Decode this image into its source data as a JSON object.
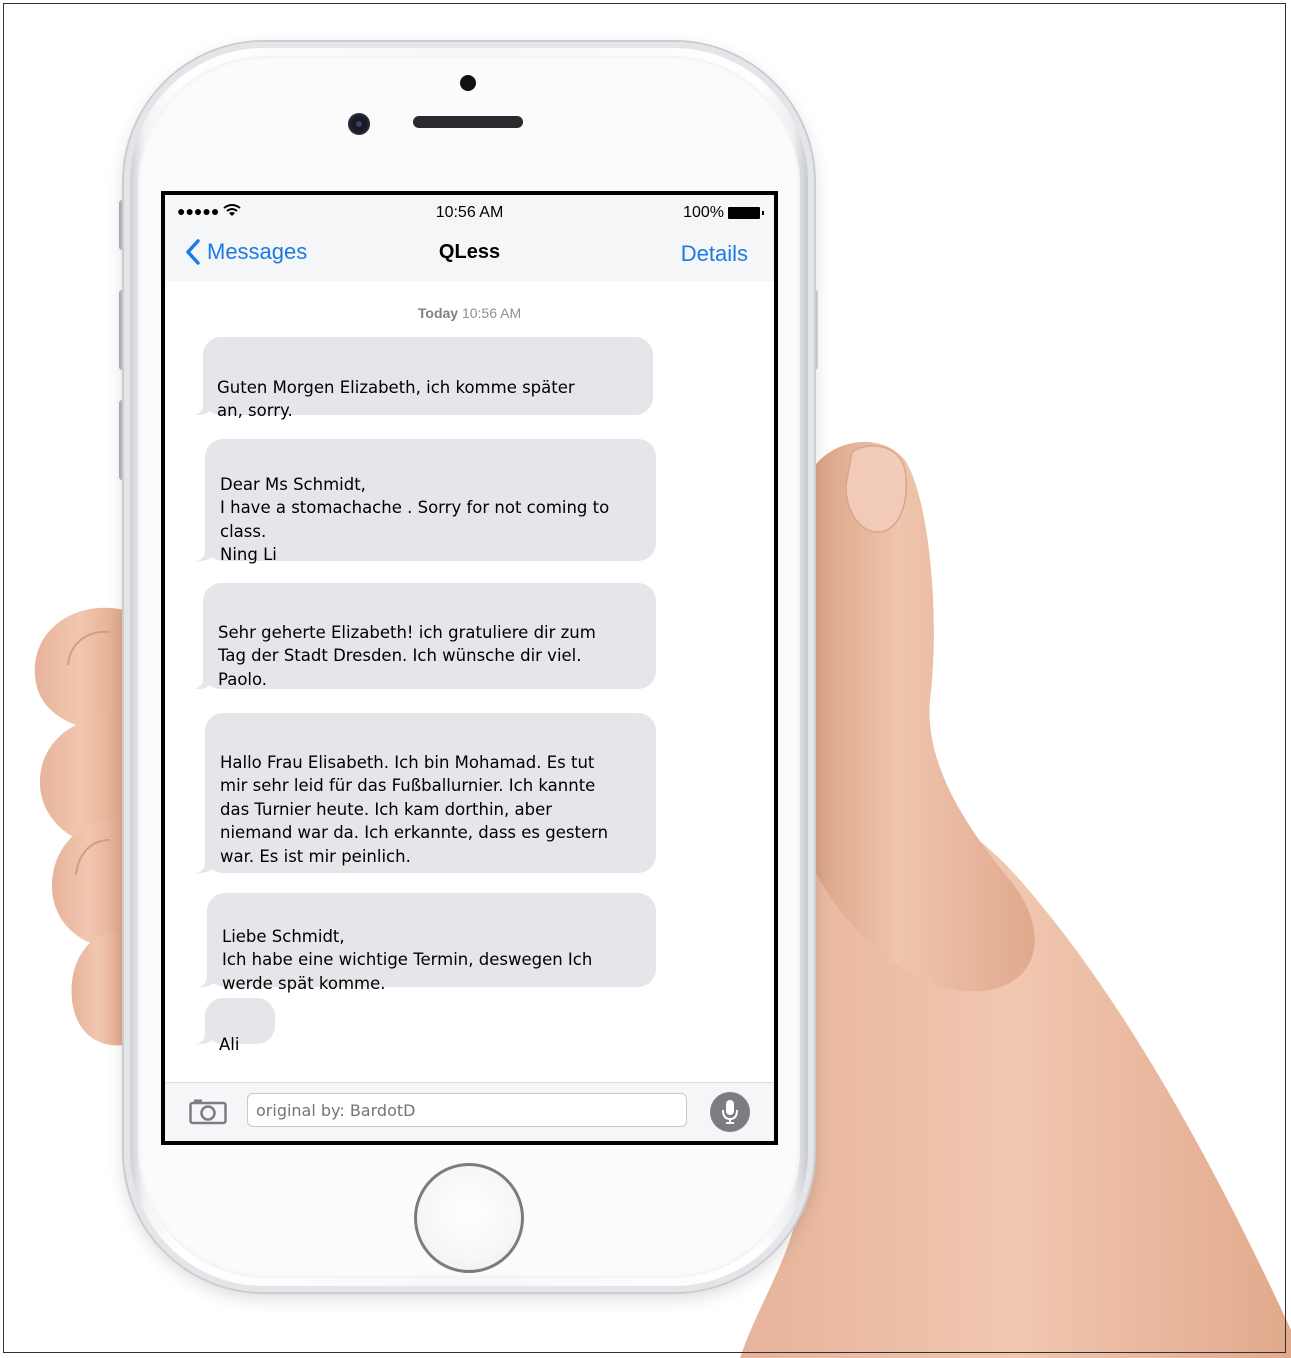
{
  "status_bar": {
    "signal": "●●●●● ",
    "time": "10:56 AM",
    "battery": "100%"
  },
  "nav": {
    "back_label": "Messages",
    "title": "QLess",
    "details_label": "Details"
  },
  "conversation": {
    "date_day": "Today",
    "date_time": "10:56 AM",
    "messages": [
      {
        "text": "Guten Morgen Elizabeth, ich komme später\nan, sorry."
      },
      {
        "text": "Dear Ms Schmidt,\nI have a stomachache . Sorry for not coming to\nclass.\nNing Li"
      },
      {
        "text": "Sehr geherte Elizabeth! ich gratuliere dir zum\nTag der Stadt Dresden. Ich wünsche dir viel.\nPaolo."
      },
      {
        "text": "Hallo Frau Elisabeth. Ich bin Mohamad. Es tut\nmir sehr leid für das Fußballurnier. Ich kannte\ndas Turnier heute. Ich kam dorthin, aber\nniemand war da. Ich erkannte, dass es gestern\nwar. Es ist mir peinlich."
      },
      {
        "text": "Liebe Schmidt,\nIch habe eine wichtige Termin, deswegen Ich\nwerde spät komme."
      },
      {
        "text": "Ali"
      }
    ]
  },
  "input": {
    "placeholder": "original by: BardotD"
  },
  "colors": {
    "accent": "#1a7be0",
    "bubble_received": "#e5e5ea",
    "skin": "#e9b9a0"
  },
  "icons": {
    "back": "chevron-left-icon",
    "camera": "camera-icon",
    "mic": "microphone-icon",
    "wifi": "wifi-icon",
    "battery": "battery-icon"
  }
}
